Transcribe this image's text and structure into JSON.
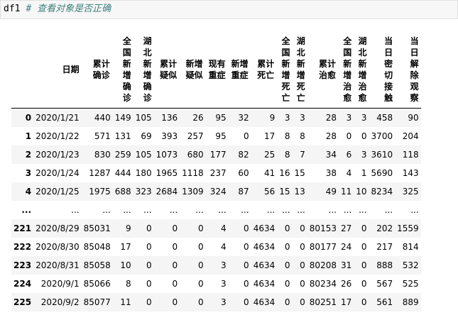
{
  "code": {
    "variable": "df1",
    "comment": "# 查看对象是否正确"
  },
  "table": {
    "columns": [
      "日期",
      "累计确诊",
      "全国新增确诊",
      "湖北新增确诊",
      "累计疑似",
      "新增疑似",
      "现有重症",
      "新增重症",
      "累计死亡",
      "全国新增死亡",
      "湖北新增死亡",
      "累计治愈",
      "全国新增治愈",
      "湖北新增治愈",
      "当日密切接触",
      "当日解除观察"
    ],
    "rows": [
      {
        "index": "0",
        "cells": [
          "2020/1/21",
          "440",
          "149",
          "105",
          "136",
          "26",
          "95",
          "32",
          "9",
          "3",
          "3",
          "28",
          "3",
          "3",
          "458",
          "90"
        ]
      },
      {
        "index": "1",
        "cells": [
          "2020/1/22",
          "571",
          "131",
          "69",
          "393",
          "257",
          "95",
          "0",
          "17",
          "8",
          "8",
          "28",
          "0",
          "0",
          "3700",
          "204"
        ]
      },
      {
        "index": "2",
        "cells": [
          "2020/1/23",
          "830",
          "259",
          "105",
          "1073",
          "680",
          "177",
          "82",
          "25",
          "8",
          "7",
          "34",
          "6",
          "3",
          "3610",
          "118"
        ]
      },
      {
        "index": "3",
        "cells": [
          "2020/1/24",
          "1287",
          "444",
          "180",
          "1965",
          "1118",
          "237",
          "60",
          "41",
          "16",
          "15",
          "38",
          "4",
          "1",
          "5690",
          "143"
        ]
      },
      {
        "index": "4",
        "cells": [
          "2020/1/25",
          "1975",
          "688",
          "323",
          "2684",
          "1309",
          "324",
          "87",
          "56",
          "15",
          "13",
          "49",
          "11",
          "10",
          "8234",
          "325"
        ]
      },
      {
        "index": "...",
        "cells": [
          "...",
          "...",
          "...",
          "...",
          "...",
          "...",
          "...",
          "...",
          "...",
          "...",
          "...",
          "...",
          "...",
          "...",
          "...",
          "..."
        ]
      },
      {
        "index": "221",
        "cells": [
          "2020/8/29",
          "85031",
          "9",
          "0",
          "0",
          "0",
          "4",
          "0",
          "4634",
          "0",
          "0",
          "80153",
          "27",
          "0",
          "202",
          "1559"
        ]
      },
      {
        "index": "222",
        "cells": [
          "2020/8/30",
          "85048",
          "17",
          "0",
          "0",
          "0",
          "4",
          "0",
          "4634",
          "0",
          "0",
          "80177",
          "24",
          "0",
          "217",
          "814"
        ]
      },
      {
        "index": "223",
        "cells": [
          "2020/8/31",
          "85058",
          "10",
          "0",
          "0",
          "0",
          "3",
          "0",
          "4634",
          "0",
          "0",
          "80208",
          "31",
          "0",
          "888",
          "532"
        ]
      },
      {
        "index": "224",
        "cells": [
          "2020/9/1",
          "85066",
          "8",
          "0",
          "0",
          "0",
          "3",
          "0",
          "4634",
          "0",
          "0",
          "80234",
          "26",
          "0",
          "567",
          "525"
        ]
      },
      {
        "index": "225",
        "cells": [
          "2020/9/2",
          "85077",
          "11",
          "0",
          "0",
          "0",
          "3",
          "0",
          "4634",
          "0",
          "0",
          "80251",
          "17",
          "0",
          "561",
          "889"
        ]
      }
    ]
  }
}
